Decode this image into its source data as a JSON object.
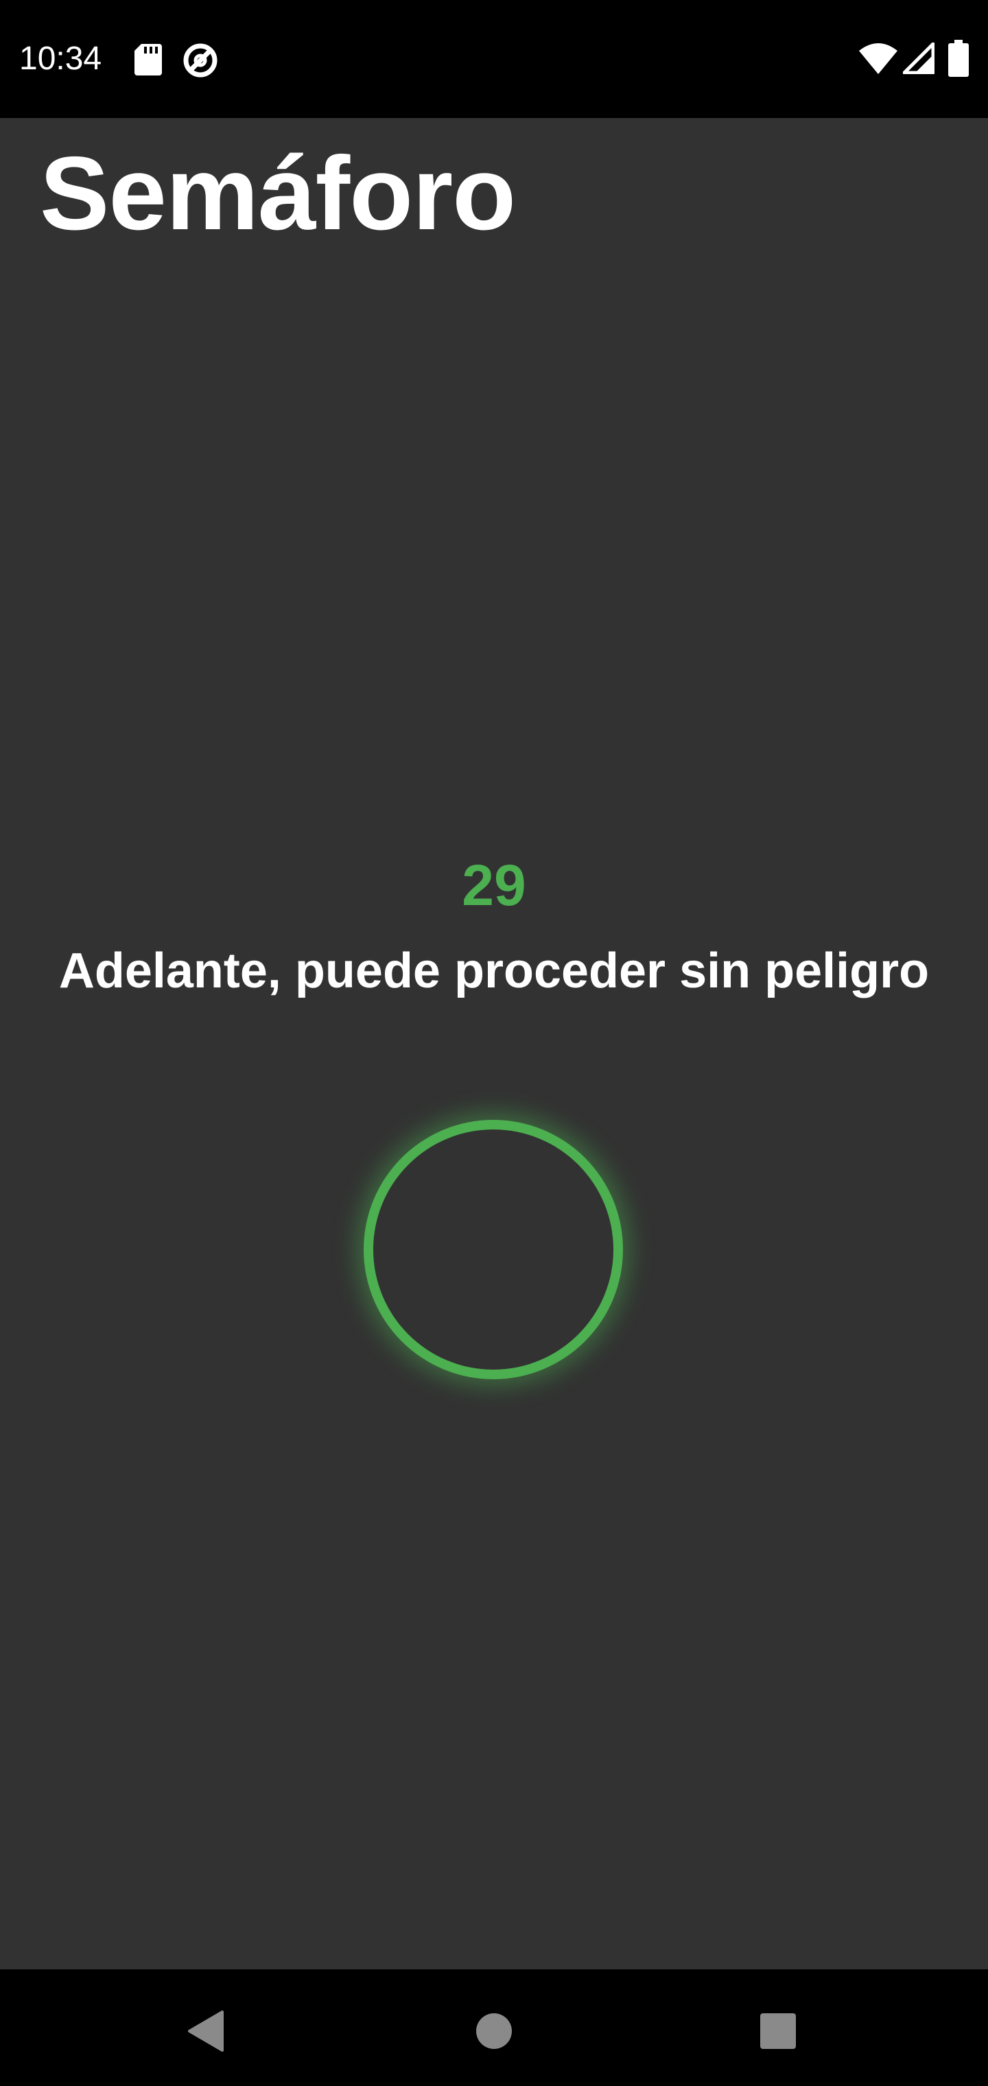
{
  "status_bar": {
    "time": "10:34",
    "left_icons": [
      "sd-card-icon",
      "do-not-disturb-icon"
    ],
    "right_icons": [
      "wifi-icon",
      "cell-signal-icon",
      "battery-icon"
    ]
  },
  "app": {
    "title": "Semáforo",
    "countdown": "29",
    "message": "Adelante, puede proceder sin peligro",
    "light_state": "green",
    "colors": {
      "background": "#323232",
      "accent_green": "#4caf50",
      "text": "#ffffff"
    }
  },
  "nav_bar": {
    "buttons": [
      "back-icon",
      "home-icon",
      "recents-icon"
    ]
  }
}
